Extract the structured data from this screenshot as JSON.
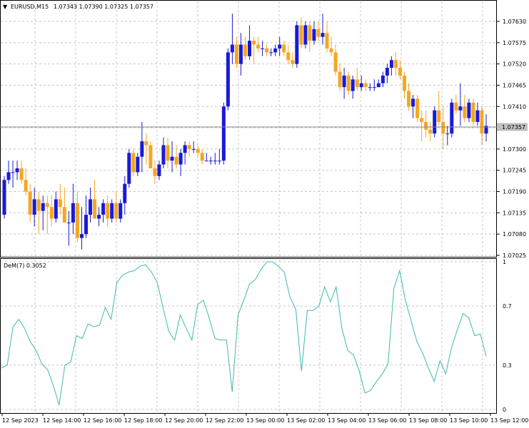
{
  "main_header": {
    "symbol_timeframe": "EURUSD,M15",
    "ohlc": "1.07343 1.07390 1.07325 1.07357"
  },
  "indicator_header": {
    "label": "DeM(7) 0.3052"
  },
  "current_price_label": "1.07357",
  "colors": {
    "bull": "#1a1ad6",
    "bear": "#f5a623",
    "grid": "#c8c8c8",
    "dem_line": "#3fb8b0",
    "price_box_bg": "#c0c0c0"
  },
  "chart_data": [
    {
      "type": "candlestick",
      "title": "EURUSD,M15",
      "y_ticks": [
        "1.07630",
        "1.07575",
        "1.07520",
        "1.07465",
        "1.07410",
        "1.07355",
        "1.07300",
        "1.07245",
        "1.07190",
        "1.07135",
        "1.07080",
        "1.07025"
      ],
      "ylim": [
        1.0702,
        1.07665
      ],
      "current_price": 1.07357,
      "candles": [
        [
          1.0713,
          1.0723,
          1.0712,
          1.0722
        ],
        [
          1.0722,
          1.0727,
          1.0721,
          1.0724
        ],
        [
          1.0724,
          1.0727,
          1.072,
          1.0724
        ],
        [
          1.0724,
          1.0727,
          1.0722,
          1.0725
        ],
        [
          1.0725,
          1.0727,
          1.0721,
          1.0722
        ],
        [
          1.0722,
          1.0725,
          1.0718,
          1.0719
        ],
        [
          1.0719,
          1.0721,
          1.0711,
          1.0713
        ],
        [
          1.0713,
          1.072,
          1.071,
          1.0717
        ],
        [
          1.0717,
          1.0719,
          1.0708,
          1.0714
        ],
        [
          1.0714,
          1.0718,
          1.0709,
          1.0716
        ],
        [
          1.0716,
          1.0718,
          1.0708,
          1.0715
        ],
        [
          1.0715,
          1.0718,
          1.071,
          1.0712
        ],
        [
          1.0712,
          1.0719,
          1.0711,
          1.0717
        ],
        [
          1.0717,
          1.0721,
          1.0713,
          1.0715
        ],
        [
          1.0715,
          1.072,
          1.0711,
          1.0711
        ],
        [
          1.0711,
          1.0714,
          1.0705,
          1.0711
        ],
        [
          1.0711,
          1.0721,
          1.0708,
          1.0716
        ],
        [
          1.0716,
          1.0719,
          1.0706,
          1.0707
        ],
        [
          1.0707,
          1.0715,
          1.0704,
          1.0708
        ],
        [
          1.0708,
          1.0718,
          1.0707,
          1.0713
        ],
        [
          1.0713,
          1.072,
          1.0711,
          1.0717
        ],
        [
          1.0717,
          1.0722,
          1.0712,
          1.0712
        ],
        [
          1.0712,
          1.0715,
          1.071,
          1.0713
        ],
        [
          1.0713,
          1.0717,
          1.0711,
          1.0716
        ],
        [
          1.0716,
          1.0718,
          1.071,
          1.0712
        ],
        [
          1.0712,
          1.0717,
          1.0711,
          1.0716
        ],
        [
          1.0716,
          1.0719,
          1.0711,
          1.0712
        ],
        [
          1.0712,
          1.0717,
          1.0711,
          1.0716
        ],
        [
          1.0716,
          1.0723,
          1.0713,
          1.0721
        ],
        [
          1.0721,
          1.073,
          1.072,
          1.0729
        ],
        [
          1.0729,
          1.073,
          1.0723,
          1.0724
        ],
        [
          1.0724,
          1.0729,
          1.0723,
          1.0728
        ],
        [
          1.0728,
          1.0737,
          1.0724,
          1.0732
        ],
        [
          1.0732,
          1.0734,
          1.0726,
          1.0731
        ],
        [
          1.0731,
          1.0732,
          1.0726,
          1.0725
        ],
        [
          1.0725,
          1.0727,
          1.0721,
          1.0723
        ],
        [
          1.0723,
          1.0727,
          1.0722,
          1.0726
        ],
        [
          1.0726,
          1.0733,
          1.0725,
          1.0731
        ],
        [
          1.0731,
          1.0733,
          1.0725,
          1.0727
        ],
        [
          1.0727,
          1.0732,
          1.0724,
          1.0728
        ],
        [
          1.0728,
          1.0731,
          1.0725,
          1.0726
        ],
        [
          1.0726,
          1.073,
          1.0723,
          1.0729
        ],
        [
          1.0729,
          1.0732,
          1.0726,
          1.0731
        ],
        [
          1.0731,
          1.0732,
          1.0728,
          1.073
        ],
        [
          1.073,
          1.0732,
          1.0729,
          1.073
        ],
        [
          1.073,
          1.0731,
          1.0728,
          1.0729
        ],
        [
          1.0729,
          1.073,
          1.0726,
          1.0727
        ],
        [
          1.0727,
          1.0729,
          1.0727,
          1.0727
        ],
        [
          1.0727,
          1.0728,
          1.0726,
          1.0727
        ],
        [
          1.0727,
          1.0729,
          1.0726,
          1.0727
        ],
        [
          1.0727,
          1.073,
          1.0726,
          1.0727
        ],
        [
          1.0727,
          1.0742,
          1.0726,
          1.0741
        ],
        [
          1.0741,
          1.0756,
          1.074,
          1.0755
        ],
        [
          1.0755,
          1.0765,
          1.0752,
          1.0757
        ],
        [
          1.0757,
          1.0759,
          1.0751,
          1.0752
        ],
        [
          1.0752,
          1.076,
          1.0749,
          1.0757
        ],
        [
          1.0757,
          1.0759,
          1.0753,
          1.0754
        ],
        [
          1.0754,
          1.0762,
          1.0753,
          1.0758
        ],
        [
          1.0758,
          1.0759,
          1.0752,
          1.0757
        ],
        [
          1.0757,
          1.0759,
          1.0755,
          1.0756
        ],
        [
          1.0756,
          1.0758,
          1.0754,
          1.0756
        ],
        [
          1.0756,
          1.0757,
          1.0754,
          1.0755
        ],
        [
          1.0755,
          1.0756,
          1.0754,
          1.0755
        ],
        [
          1.0755,
          1.0757,
          1.0754,
          1.0756
        ],
        [
          1.0756,
          1.0759,
          1.0754,
          1.0757
        ],
        [
          1.0757,
          1.0758,
          1.0754,
          1.0755
        ],
        [
          1.0755,
          1.0757,
          1.0752,
          1.0753
        ],
        [
          1.0753,
          1.0755,
          1.0751,
          1.0752
        ],
        [
          1.0752,
          1.0763,
          1.0751,
          1.0762
        ],
        [
          1.0762,
          1.0764,
          1.0756,
          1.0757
        ],
        [
          1.0757,
          1.0763,
          1.0756,
          1.0762
        ],
        [
          1.0762,
          1.0763,
          1.0755,
          1.0758
        ],
        [
          1.0758,
          1.0763,
          1.0757,
          1.0761
        ],
        [
          1.0761,
          1.0763,
          1.0758,
          1.0759
        ],
        [
          1.0759,
          1.0765,
          1.0757,
          1.076
        ],
        [
          1.076,
          1.0763,
          1.0755,
          1.0756
        ],
        [
          1.0756,
          1.0759,
          1.0754,
          1.0755
        ],
        [
          1.0755,
          1.0757,
          1.0749,
          1.075
        ],
        [
          1.075,
          1.0752,
          1.0745,
          1.0746
        ],
        [
          1.0746,
          1.0751,
          1.0743,
          1.0749
        ],
        [
          1.0749,
          1.075,
          1.0744,
          1.0745
        ],
        [
          1.0745,
          1.0749,
          1.0743,
          1.0748
        ],
        [
          1.0748,
          1.0751,
          1.0745,
          1.0746
        ],
        [
          1.0746,
          1.0749,
          1.0745,
          1.0747
        ],
        [
          1.0747,
          1.0748,
          1.0745,
          1.0746
        ],
        [
          1.0746,
          1.0747,
          1.0745,
          1.0746
        ],
        [
          1.0746,
          1.0748,
          1.0745,
          1.0746
        ],
        [
          1.0746,
          1.0748,
          1.0746,
          1.0747
        ],
        [
          1.0747,
          1.075,
          1.0746,
          1.0749
        ],
        [
          1.0749,
          1.0752,
          1.0747,
          1.0751
        ],
        [
          1.0751,
          1.0754,
          1.0749,
          1.0753
        ],
        [
          1.0753,
          1.0755,
          1.0749,
          1.0751
        ],
        [
          1.0751,
          1.0753,
          1.0748,
          1.0749
        ],
        [
          1.0749,
          1.075,
          1.0743,
          1.0745
        ],
        [
          1.0745,
          1.0747,
          1.074,
          1.0741
        ],
        [
          1.0741,
          1.0744,
          1.0738,
          1.0743
        ],
        [
          1.0743,
          1.0744,
          1.0737,
          1.0738
        ],
        [
          1.0738,
          1.074,
          1.0732,
          1.0737
        ],
        [
          1.0737,
          1.074,
          1.0733,
          1.0735
        ],
        [
          1.0735,
          1.0737,
          1.0732,
          1.0734
        ],
        [
          1.0734,
          1.0741,
          1.0733,
          1.074
        ],
        [
          1.074,
          1.0745,
          1.0736,
          1.0737
        ],
        [
          1.0737,
          1.0741,
          1.073,
          1.0734
        ],
        [
          1.0734,
          1.0736,
          1.0731,
          1.0734
        ],
        [
          1.0734,
          1.0743,
          1.0733,
          1.0742
        ],
        [
          1.0742,
          1.0744,
          1.0739,
          1.074
        ],
        [
          1.074,
          1.0747,
          1.0736,
          1.0741
        ],
        [
          1.0741,
          1.0744,
          1.0737,
          1.0738
        ],
        [
          1.0738,
          1.0743,
          1.0737,
          1.0742
        ],
        [
          1.0742,
          1.0743,
          1.0736,
          1.0737
        ],
        [
          1.0737,
          1.0742,
          1.0736,
          1.074
        ],
        [
          1.074,
          1.0741,
          1.0731,
          1.0734
        ],
        [
          1.0734,
          1.0739,
          1.0732,
          1.0736
        ]
      ]
    },
    {
      "type": "line",
      "title": "DeM(7) 0.3052",
      "series_name": "DeM(7)",
      "current_value": 0.3052,
      "y_ticks": [
        "1",
        "0.7",
        "0.3",
        "0"
      ],
      "ylim": [
        -0.02,
        1.04
      ],
      "values": [
        0.28,
        0.3,
        0.56,
        0.61,
        0.55,
        0.46,
        0.4,
        0.31,
        0.27,
        0.16,
        0.03,
        0.3,
        0.32,
        0.5,
        0.48,
        0.58,
        0.56,
        0.57,
        0.69,
        0.61,
        0.86,
        0.91,
        0.93,
        0.94,
        0.97,
        0.98,
        0.93,
        0.86,
        0.69,
        0.53,
        0.47,
        0.64,
        0.55,
        0.47,
        0.71,
        0.74,
        0.62,
        0.48,
        0.47,
        0.47,
        0.12,
        0.64,
        0.74,
        0.85,
        0.88,
        0.95,
        1.0,
        1.0,
        0.97,
        0.93,
        0.76,
        0.68,
        0.26,
        0.67,
        0.67,
        0.7,
        0.83,
        0.73,
        0.83,
        0.55,
        0.4,
        0.37,
        0.26,
        0.11,
        0.13,
        0.19,
        0.24,
        0.31,
        0.82,
        0.94,
        0.74,
        0.6,
        0.46,
        0.38,
        0.28,
        0.19,
        0.33,
        0.24,
        0.42,
        0.54,
        0.65,
        0.62,
        0.5,
        0.51,
        0.36
      ],
      "x_labels": [
        "12 Sep 2023",
        "12 Sep 14:00",
        "12 Sep 16:00",
        "12 Sep 18:00",
        "12 Sep 20:00",
        "12 Sep 22:00",
        "13 Sep 00:00",
        "13 Sep 02:00",
        "13 Sep 04:00",
        "13 Sep 06:00",
        "13 Sep 08:00",
        "13 Sep 10:00",
        "13 Sep 12:00"
      ]
    }
  ]
}
